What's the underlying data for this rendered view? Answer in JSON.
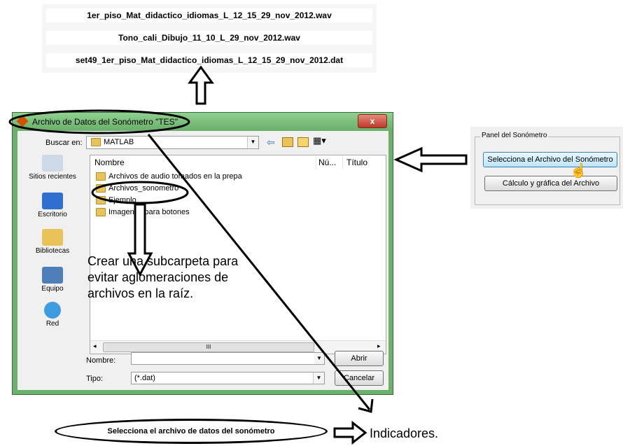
{
  "file_list": [
    "1er_piso_Mat_didactico_idiomas_L_12_15_29_nov_2012.wav",
    "Tono_cali_Dibujo_11_10_L_29_nov_2012.wav",
    "set49_1er_piso_Mat_didactico_idiomas_L_12_15_29_nov_2012.dat"
  ],
  "dialog": {
    "title": "Archivo de Datos del Sonómetro \"TES\"",
    "close_label": "x",
    "look_in_label": "Buscar en:",
    "look_in_value": "MATLAB",
    "places": [
      "Sitios recientes",
      "Escritorio",
      "Bibliotecas",
      "Equipo",
      "Red"
    ],
    "columns": [
      "Nombre",
      "Nú...",
      "Título"
    ],
    "files": [
      "Archivos de audio tomados en la prepa",
      "Archivos_sonometro",
      "Ejemplo",
      "Imagenes para botones"
    ],
    "scrollbar_label": "III",
    "filename_label": "Nombre:",
    "filename_value": "",
    "type_label": "Tipo:",
    "type_value": "(*.dat)",
    "open_button": "Abrir",
    "cancel_button": "Cancelar"
  },
  "panel": {
    "title": "Panel del Sonómetro",
    "select_button": "Selecciona el Archivo del Sonómetro",
    "calc_button": "Cálculo y gráfica del Archivo"
  },
  "annotation_note": "Crear una subcarpeta para evitar aglomeraciones de archivos en la raíz.",
  "status_text": "Selecciona el archivo de datos del sonómetro",
  "indicadores_label": "Indicadores.",
  "colors": {
    "title_bar": "#6bb06b",
    "close_button": "#c0392b",
    "folder": "#e9c25a"
  }
}
